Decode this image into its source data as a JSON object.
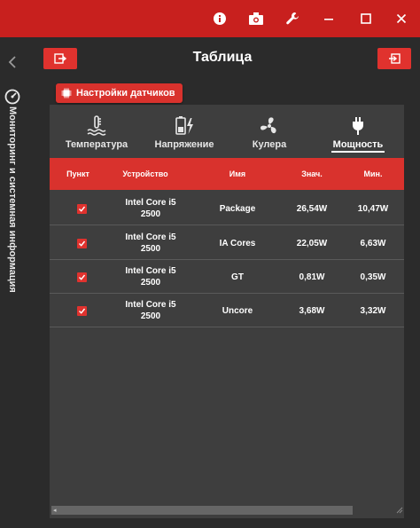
{
  "window": {
    "title": "Таблица"
  },
  "sidebar": {
    "vertical_label": "Мониторинг и системная информация"
  },
  "badge": {
    "label": "Настройки датчиков"
  },
  "tabs": [
    {
      "label": "Температура",
      "icon": "thermometer-icon"
    },
    {
      "label": "Напряжение",
      "icon": "battery-bolt-icon"
    },
    {
      "label": "Кулера",
      "icon": "fan-icon"
    },
    {
      "label": "Мощность",
      "icon": "power-plug-icon",
      "active": true
    }
  ],
  "table": {
    "columns": [
      "Пункт",
      "Устройство",
      "Имя",
      "Знач.",
      "Мин."
    ],
    "rows": [
      {
        "checked": true,
        "device": "Intel Core i5 2500",
        "name": "Package",
        "value": "26,54W",
        "min": "10,47W"
      },
      {
        "checked": true,
        "device": "Intel Core i5 2500",
        "name": "IA Cores",
        "value": "22,05W",
        "min": "6,63W"
      },
      {
        "checked": true,
        "device": "Intel Core i5 2500",
        "name": "GT",
        "value": "0,81W",
        "min": "0,35W"
      },
      {
        "checked": true,
        "device": "Intel Core i5 2500",
        "name": "Uncore",
        "value": "3,68W",
        "min": "3,32W"
      }
    ]
  },
  "colors": {
    "accent": "#d9322d",
    "titlebar": "#c8201e",
    "background": "#2b2b2b",
    "panel": "#3e3e3e"
  }
}
